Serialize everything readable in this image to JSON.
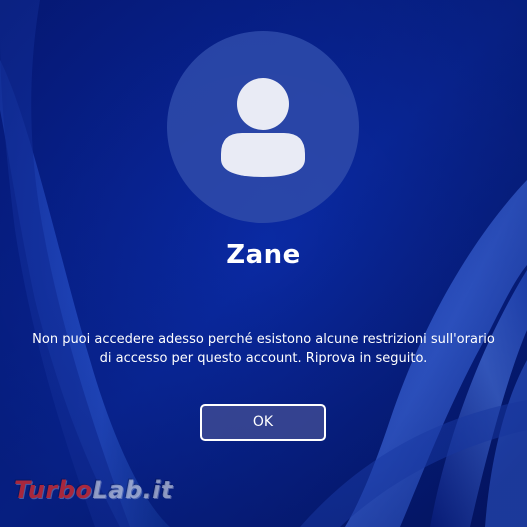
{
  "lock_screen": {
    "user": {
      "name": "Zane",
      "avatar_icon": "user-silhouette-icon"
    },
    "message": "Non puoi accedere adesso perché esistono alcune restrizioni sull'orario di accesso per questo account. Riprova in seguito.",
    "ok_button_label": "OK"
  },
  "watermark": {
    "brand_part1": "Turbo",
    "brand_part2": "Lab.it"
  },
  "colors": {
    "background_dark": "#031a7a",
    "background_mid": "#0a2fb0",
    "ribbon_light": "#4f7cf0",
    "avatar_circle": "#2e4aaa",
    "avatar_glyph": "#e9ebf5",
    "button_fill": "#4650a0",
    "watermark_red": "#d62a2a"
  }
}
